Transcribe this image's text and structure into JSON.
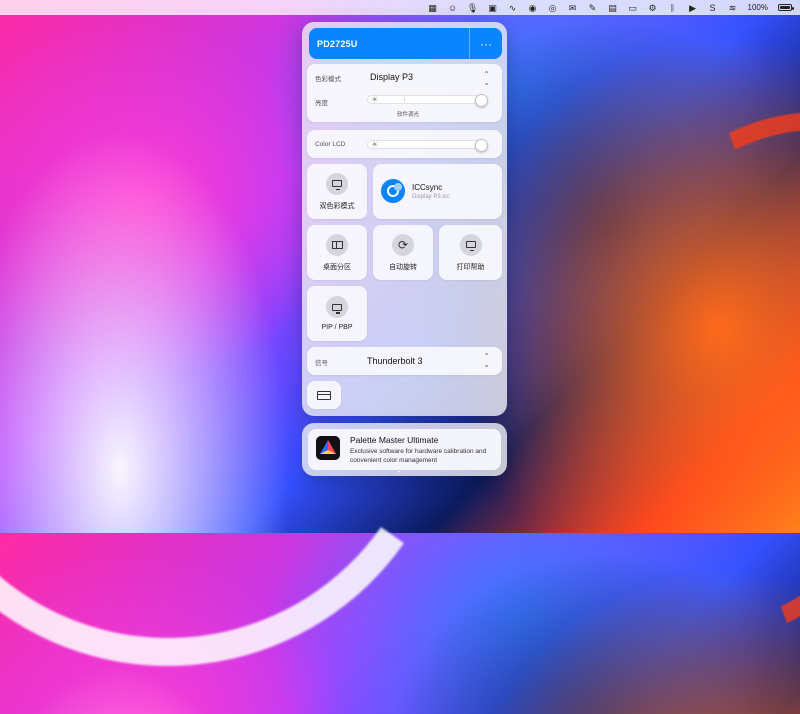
{
  "menubar": {
    "icons": [
      "grid-icon",
      "smiley-icon",
      "mic-icon",
      "qr-icon",
      "activity-icon",
      "eye-icon",
      "wechat-icon",
      "chat-icon",
      "note-icon",
      "folder-icon",
      "screen-icon",
      "cog-icon",
      "bluetooth-icon",
      "play-icon",
      "s-icon",
      "wifi-icon",
      "battery-icon"
    ],
    "battery_percent": "100%",
    "battery_level": 1.0
  },
  "panel": {
    "title": "PD2725U",
    "more": "···",
    "color_mode": {
      "label": "色彩模式",
      "value": "Display P3"
    },
    "brightness": {
      "label": "亮度",
      "sublabel": "软件调光",
      "level": 0.98
    },
    "color_lcd": {
      "label": "Color LCD",
      "level": 0.98
    },
    "tiles": {
      "dual_color": "双色彩模式",
      "icc": {
        "title": "ICCsync",
        "subtitle": "Display P3.icc"
      },
      "desktop_partition": "桌面分区",
      "auto_rotate": "自动旋转",
      "print_help": "打印帮助",
      "pip_pbp": "PIP / PBP"
    },
    "signal": {
      "label": "信号",
      "value": "Thunderbolt 3"
    }
  },
  "promo": {
    "title": "Palette Master Ultimate",
    "desc": "Exclusive software for hardware calibration and convenient color management"
  },
  "colors": {
    "accent": "#0a84ff",
    "panel": "#ebebf2"
  }
}
